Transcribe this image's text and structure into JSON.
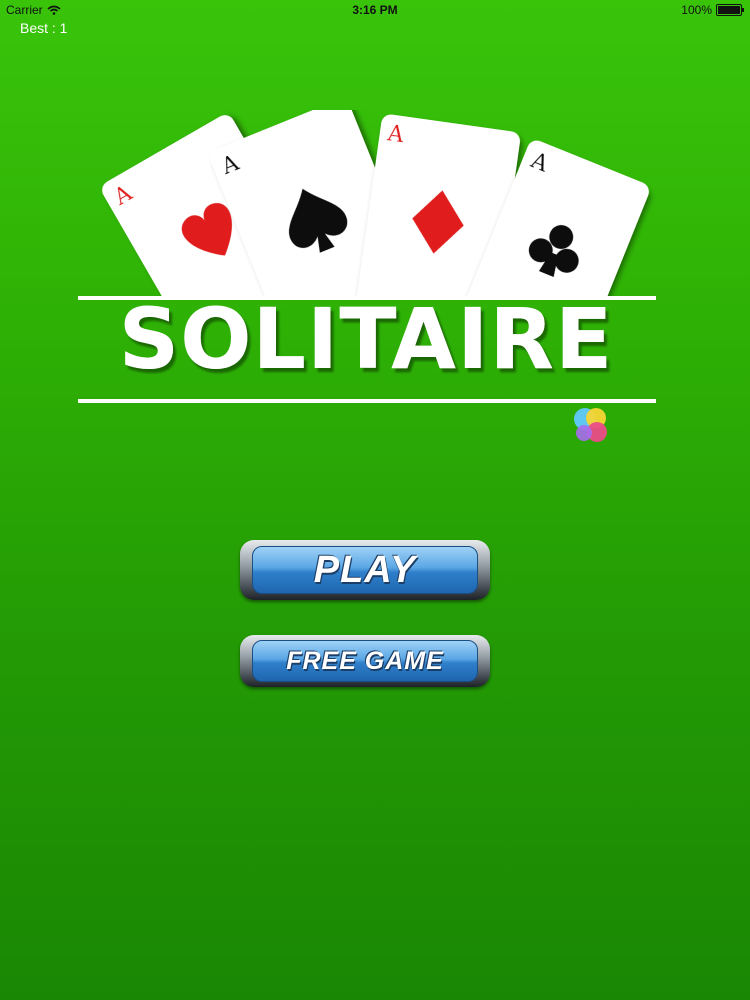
{
  "status_bar": {
    "carrier": "Carrier",
    "time": "3:16 PM",
    "battery": "100%"
  },
  "best": {
    "label": "Best : 1"
  },
  "logo": {
    "title": "SOLITAIRE",
    "card_rank": "A",
    "cards": [
      "hearts",
      "spades",
      "diamonds",
      "clubs"
    ]
  },
  "menu": {
    "play_label": "PLAY",
    "free_game_label": "FREE GAME"
  },
  "icons": {
    "wifi": "wifi-icon",
    "battery": "battery-icon",
    "game_center": "game-center-icon"
  }
}
